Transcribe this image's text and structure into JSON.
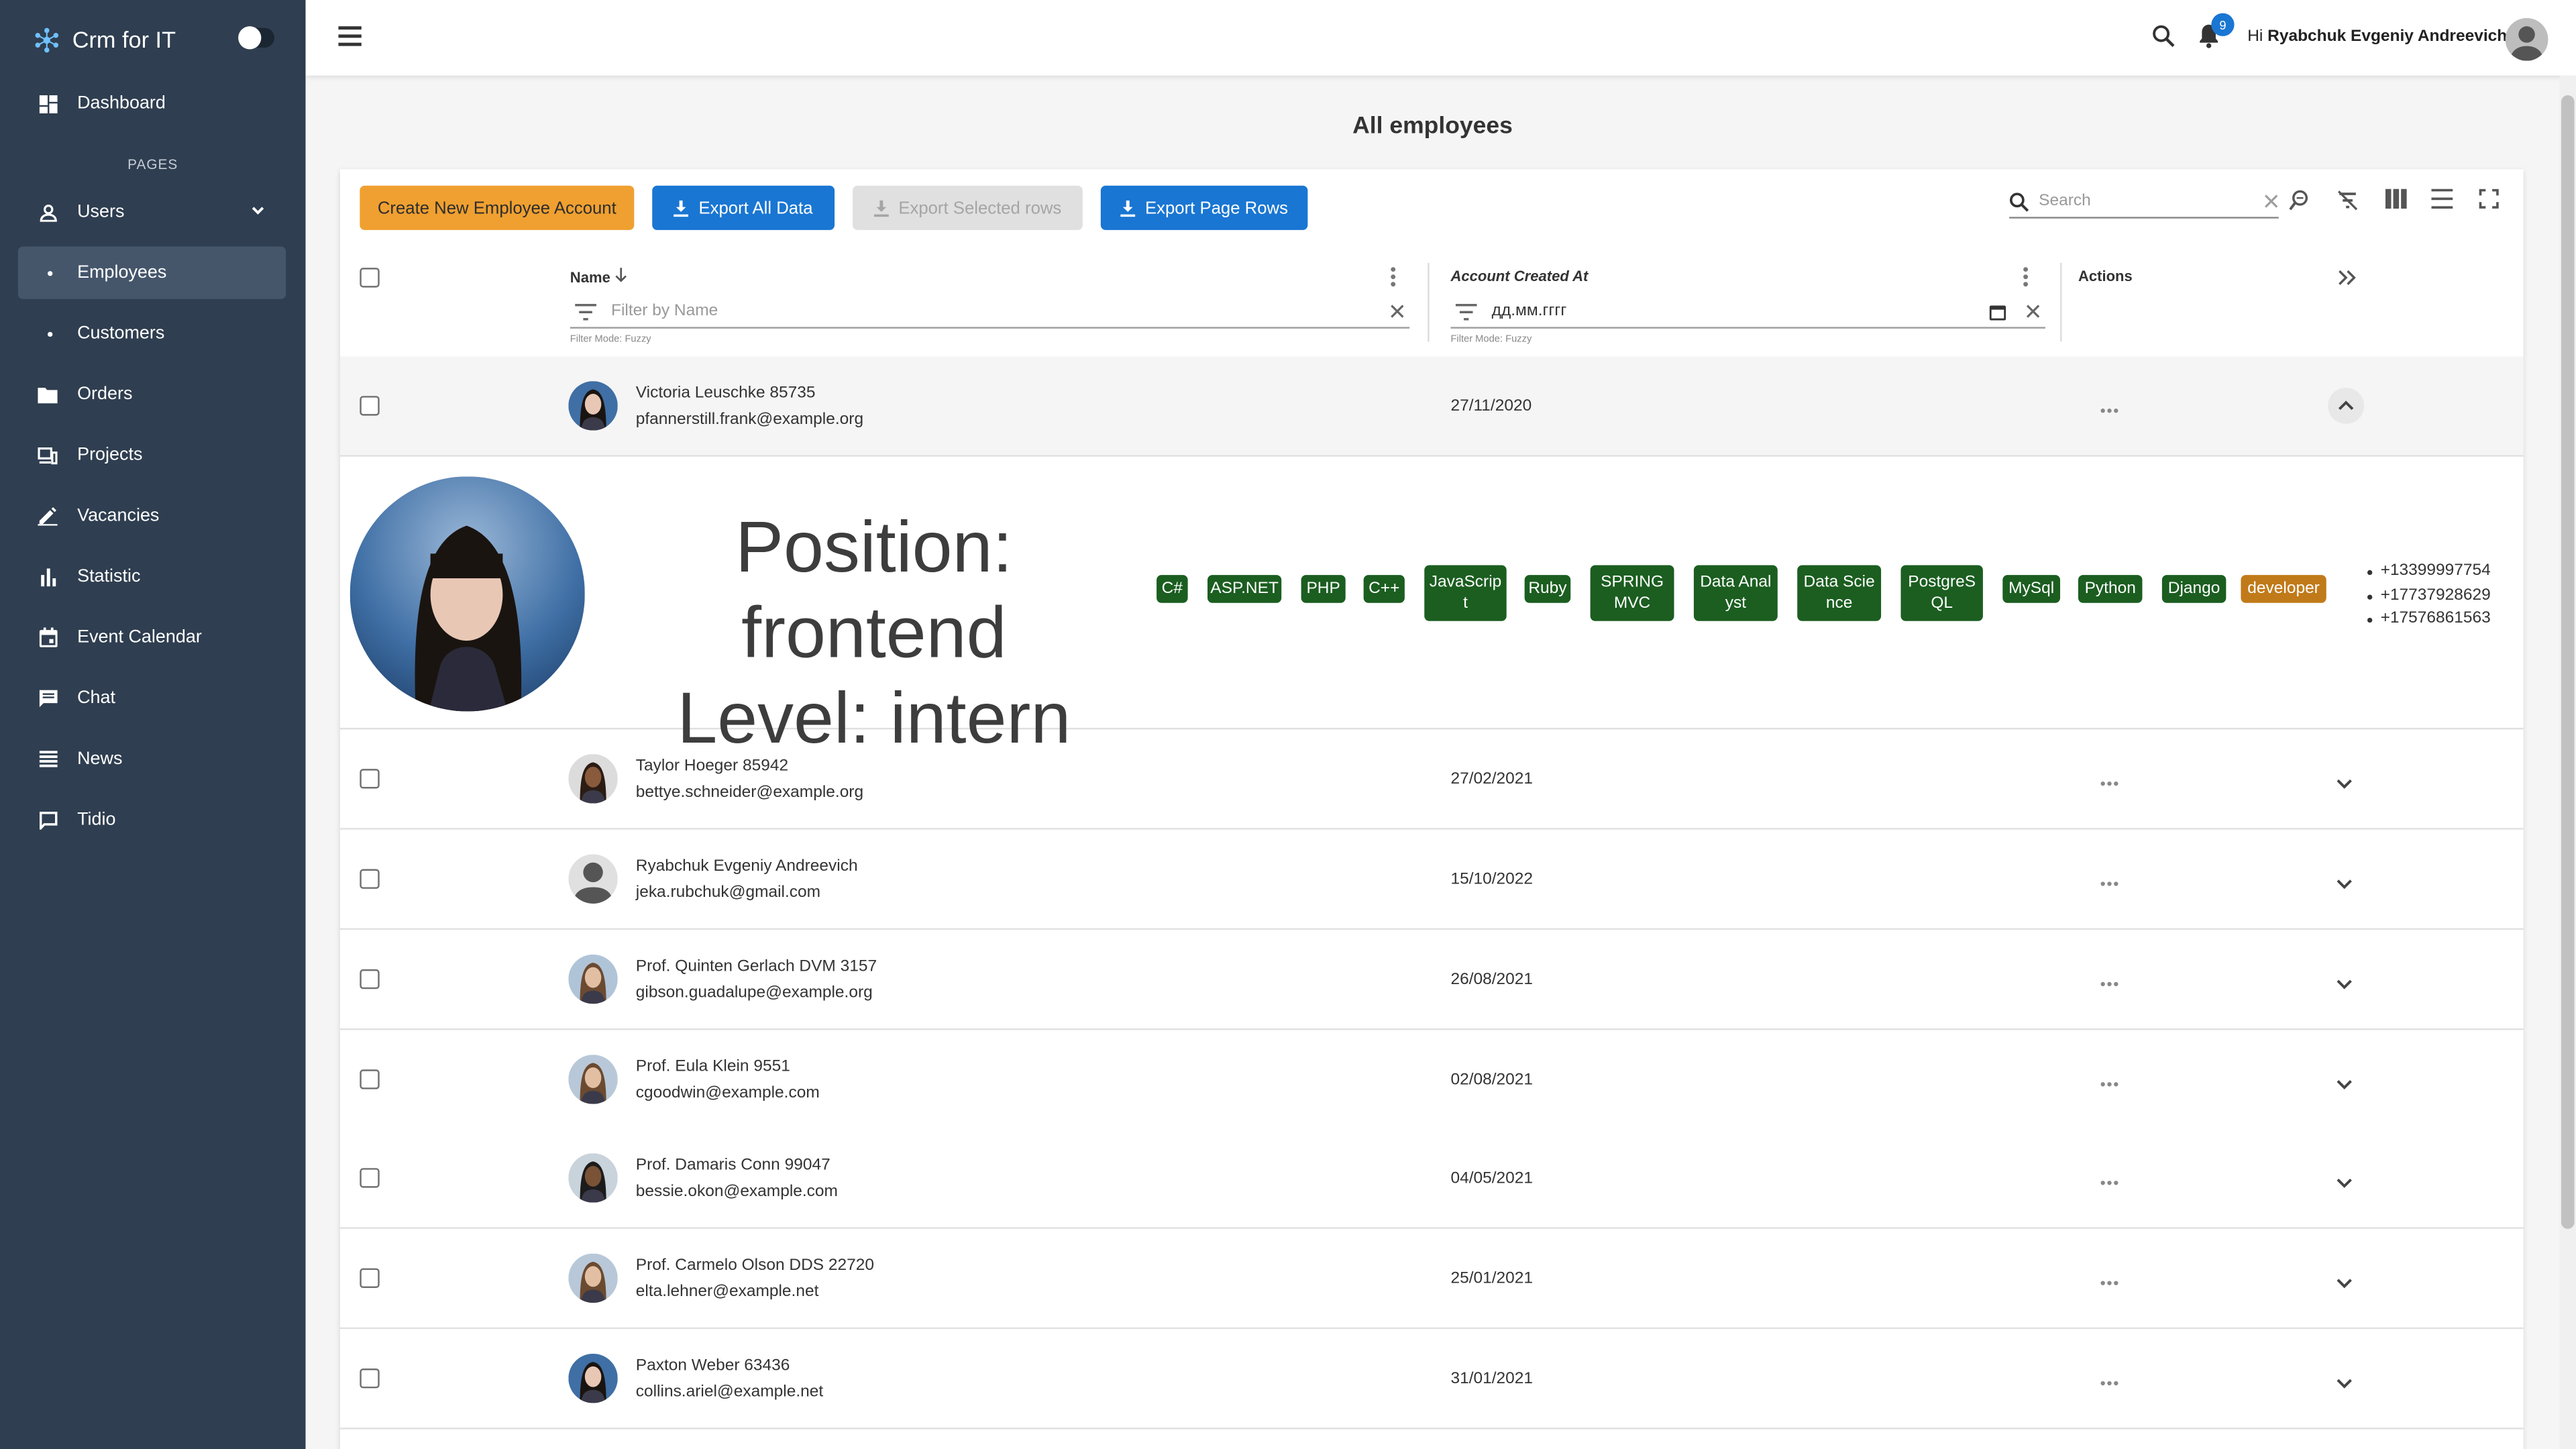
{
  "app": {
    "brand": "Crm for IT"
  },
  "sidebar": {
    "section_label": "PAGES",
    "items": [
      {
        "label": "Dashboard",
        "icon": "dashboard-icon"
      },
      {
        "label": "Users",
        "icon": "user-icon"
      },
      {
        "label": "Employees",
        "icon": "dot-icon",
        "active": true
      },
      {
        "label": "Customers",
        "icon": "dot-icon"
      },
      {
        "label": "Orders",
        "icon": "folder-icon"
      },
      {
        "label": "Projects",
        "icon": "projects-icon"
      },
      {
        "label": "Vacancies",
        "icon": "pen-icon"
      },
      {
        "label": "Statistic",
        "icon": "bar-chart-icon"
      },
      {
        "label": "Event Calendar",
        "icon": "calendar-icon"
      },
      {
        "label": "Chat",
        "icon": "chat-icon"
      },
      {
        "label": "News",
        "icon": "news-icon"
      },
      {
        "label": "Tidio",
        "icon": "tidio-icon"
      }
    ]
  },
  "header": {
    "notifications_count": "9",
    "greeting_prefix": "Hi",
    "user_name": "Ryabchuk Evgeniy Andreevich"
  },
  "page": {
    "title": "All employees"
  },
  "toolbar": {
    "create_label": "Create New Employee Account",
    "export_all_label": "Export All Data",
    "export_selected_label": "Export Selected rows",
    "export_page_label": "Export Page Rows",
    "search_placeholder": "Search"
  },
  "table": {
    "columns": {
      "name": "Name",
      "created": "Account Created At",
      "actions": "Actions"
    },
    "filters": {
      "name_placeholder": "Filter by Name",
      "date_placeholder": "дд.мм.гггг",
      "mode_label": "Filter Mode: Fuzzy"
    },
    "rows": [
      {
        "name": "Victoria Leuschke 85735",
        "email": "pfannerstill.frank@example.org",
        "created": "27/11/2020",
        "expanded": true
      },
      {
        "name": "Taylor Hoeger 85942",
        "email": "bettye.schneider@example.org",
        "created": "27/02/2021"
      },
      {
        "name": "Ryabchuk Evgeniy Andreevich",
        "email": "jeka.rubchuk@gmail.com",
        "created": "15/10/2022"
      },
      {
        "name": "Prof. Quinten Gerlach DVM 3157",
        "email": "gibson.guadalupe@example.org",
        "created": "26/08/2021"
      },
      {
        "name": "Prof. Eula Klein 9551",
        "email": "cgoodwin@example.com",
        "created": "02/08/2021"
      },
      {
        "name": "Prof. Damaris Conn 99047",
        "email": "bessie.okon@example.com",
        "created": "04/05/2021"
      },
      {
        "name": "Prof. Carmelo Olson DDS 22720",
        "email": "elta.lehner@example.net",
        "created": "25/01/2021"
      },
      {
        "name": "Paxton Weber 63436",
        "email": "collins.ariel@example.net",
        "created": "31/01/2021"
      }
    ],
    "detail": {
      "position_line": "Position: frontend",
      "level_line": "Level: intern",
      "skills": [
        "C#",
        "ASP.NET",
        "PHP",
        "C++",
        "JavaScrip t",
        "Ruby",
        "SPRING MVC",
        "Data Anal yst",
        "Data Scie nce",
        "PostgreS QL",
        "MySql",
        "Python",
        "Django"
      ],
      "role_tag": "developer",
      "phones": [
        "+13399997754",
        "+17737928629",
        "+17576861563"
      ]
    }
  },
  "colors": {
    "sidebar_bg": "#2f3e50",
    "primary": "#1976d2",
    "create_button": "#f0a030",
    "skill_tag": "#1b5e20",
    "role_tag": "#c17a19"
  }
}
